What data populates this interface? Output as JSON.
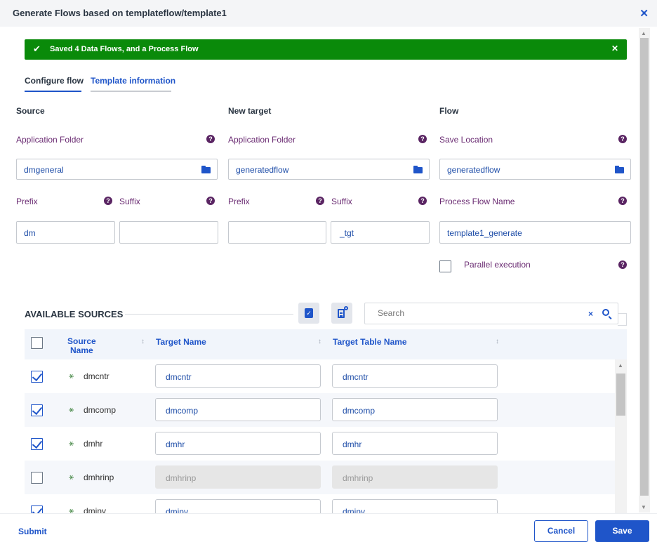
{
  "dialog": {
    "title": "Generate Flows based on templateflow/template1",
    "close_icon": "close-icon",
    "banner_message": "Saved 4 Data Flows, and a Process Flow",
    "banner_color": "#0a8a0a"
  },
  "tabs": [
    {
      "label": "Configure flow",
      "active": true
    },
    {
      "label": "Template information",
      "active": false
    }
  ],
  "source": {
    "header": "Source",
    "app_folder_label": "Application Folder",
    "app_folder_value": "dmgeneral",
    "prefix_label": "Prefix",
    "prefix_value": "dm",
    "suffix_label": "Suffix",
    "suffix_value": ""
  },
  "new_target": {
    "header": "New target",
    "app_folder_label": "Application Folder",
    "app_folder_value": "generatedflow",
    "prefix_label": "Prefix",
    "prefix_value": "",
    "suffix_label": "Suffix",
    "suffix_value": "_tgt"
  },
  "flow": {
    "header": "Flow",
    "save_location_label": "Save Location",
    "save_location_value": "generatedflow",
    "process_flow_name_label": "Process Flow Name",
    "process_flow_name_value": "template1_generate",
    "parallel_label": "Parallel execution",
    "parallel_checked": false
  },
  "available_sources": {
    "title": "AVAILABLE SOURCES",
    "search_placeholder": "Search",
    "search_clear": "×",
    "columns": [
      "Source Name",
      "Target Name",
      "Target Table Name"
    ],
    "column_source_line1": "Source",
    "column_source_line2": "Name",
    "rows": [
      {
        "checked": true,
        "source": "dmcntr",
        "target": "dmcntr",
        "table": "dmcntr"
      },
      {
        "checked": true,
        "source": "dmcomp",
        "target": "dmcomp",
        "table": "dmcomp"
      },
      {
        "checked": true,
        "source": "dmhr",
        "target": "dmhr",
        "table": "dmhr"
      },
      {
        "checked": false,
        "source": "dmhrinp",
        "target": "dmhrinp",
        "table": "dmhrinp"
      },
      {
        "checked": true,
        "source": "dminv",
        "target": "dminv",
        "table": "dminv"
      }
    ]
  },
  "footer": {
    "submit": "Submit",
    "cancel": "Cancel",
    "save": "Save"
  },
  "colors": {
    "accent": "#1f55c9",
    "label_purple": "#6a2b72",
    "success_green": "#0a8a0a"
  }
}
